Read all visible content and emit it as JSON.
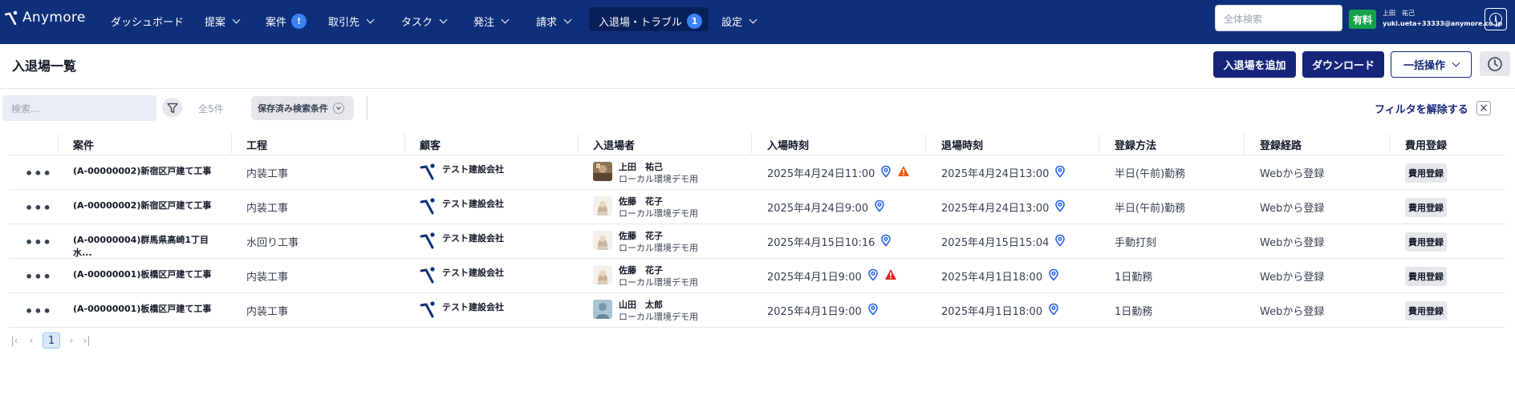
{
  "app": {
    "logo_text": "Anymore"
  },
  "nav": {
    "dashboard": "ダッシュボード",
    "proposal": "提案",
    "case": "案件",
    "case_badge": "!",
    "clients": "取引先",
    "tasks": "タスク",
    "orders": "発注",
    "billing": "請求",
    "entry": "入退場・トラブル",
    "entry_badge": "1",
    "settings": "設定"
  },
  "header": {
    "search_placeholder": "全体検索",
    "paid_label": "有料",
    "user_name": "上田　祐己",
    "user_email": "yuki.ueta+33333@anymore.co.jp"
  },
  "page": {
    "title": "入退場一覧",
    "add_button": "入退場を追加",
    "download_button": "ダウンロード",
    "bulk_button": "一括操作"
  },
  "filter": {
    "search_placeholder": "検索...",
    "count": "全5件",
    "saved_search": "保存済み検索条件",
    "clear_filter": "フィルタを解除する",
    "close": "×"
  },
  "table": {
    "columns": [
      "案件",
      "工程",
      "顧客",
      "入退場者",
      "入場時刻",
      "退場時刻",
      "登録方法",
      "登録経路",
      "費用登録"
    ],
    "rows": [
      {
        "menu": "•••",
        "case": "(A-00000002)新宿区戸建て工事",
        "process": "内装工事",
        "client": "テスト建設会社",
        "person_name": "上田　祐己",
        "person_sub": "ローカル環境デモ用",
        "avatar": "photo",
        "entry": "2025年4月24日11:00",
        "entry_warning": "orange",
        "exit": "2025年4月24日13:00",
        "method": "半日(午前)勤務",
        "route": "Webから登録",
        "fee": "費用登録"
      },
      {
        "menu": "•••",
        "case": "(A-00000002)新宿区戸建て工事",
        "process": "内装工事",
        "client": "テスト建設会社",
        "person_name": "佐藤　花子",
        "person_sub": "ローカル環境デモ用",
        "avatar": "woman",
        "entry": "2025年4月24日9:00",
        "entry_warning": "",
        "exit": "2025年4月24日13:00",
        "method": "半日(午前)勤務",
        "route": "Webから登録",
        "fee": "費用登録"
      },
      {
        "menu": "•••",
        "case": "(A-00000004)群馬県高崎1丁目水...",
        "process": "水回り工事",
        "client": "テスト建設会社",
        "person_name": "佐藤　花子",
        "person_sub": "ローカル環境デモ用",
        "avatar": "woman",
        "entry": "2025年4月15日10:16",
        "entry_warning": "",
        "exit": "2025年4月15日15:04",
        "method": "手動打刻",
        "route": "Webから登録",
        "fee": "費用登録"
      },
      {
        "menu": "•••",
        "case": "(A-00000001)板橋区戸建て工事",
        "process": "内装工事",
        "client": "テスト建設会社",
        "person_name": "佐藤　花子",
        "person_sub": "ローカル環境デモ用",
        "avatar": "woman",
        "entry": "2025年4月1日9:00",
        "entry_warning": "red",
        "exit": "2025年4月1日18:00",
        "method": "1日勤務",
        "route": "Webから登録",
        "fee": "費用登録"
      },
      {
        "menu": "•••",
        "case": "(A-00000001)板橋区戸建て工事",
        "process": "内装工事",
        "client": "テスト建設会社",
        "person_name": "山田　太郎",
        "person_sub": "ローカル環境デモ用",
        "avatar": "man",
        "entry": "2025年4月1日9:00",
        "entry_warning": "",
        "exit": "2025年4月1日18:00",
        "method": "1日勤務",
        "route": "Webから登録",
        "fee": "費用登録"
      }
    ]
  },
  "pagination": {
    "first": "|‹",
    "prev": "‹",
    "current": "1",
    "next": "›",
    "last": "›|"
  },
  "colors": {
    "nav_bg": "#0e2f7a",
    "primary": "#15267a",
    "paid": "#16a34a",
    "warn_orange": "#ea580c",
    "warn_red": "#dc2626",
    "pin": "#2563eb"
  }
}
